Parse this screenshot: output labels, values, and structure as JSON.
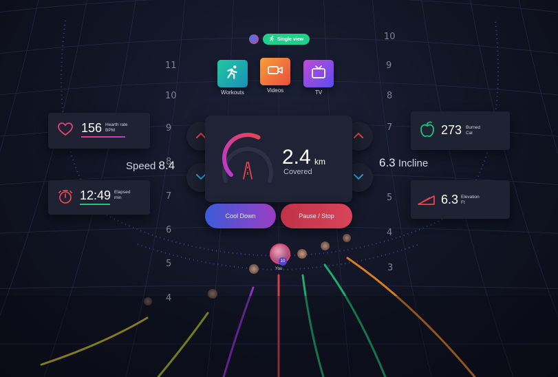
{
  "view_toggle": {
    "label": "Single view"
  },
  "apps": [
    {
      "label": "Workouts",
      "icon": "runner-icon",
      "color": "#18b8a6"
    },
    {
      "label": "Videos",
      "icon": "video-camera-icon",
      "color": "#f1663b"
    },
    {
      "label": "TV",
      "icon": "tv-icon",
      "color": "#7b4cf0"
    }
  ],
  "heart_rate": {
    "value": "156",
    "label1": "Hearth rate",
    "label2": "BPM",
    "icon": "heart-icon"
  },
  "elapsed": {
    "value": "12:49",
    "label1": "Elapsed",
    "label2": "min",
    "icon": "stopwatch-icon"
  },
  "calories": {
    "value": "273",
    "label1": "Burned",
    "label2": "Cal",
    "icon": "apple-icon"
  },
  "elevation": {
    "value": "6.3",
    "label1": "Elevation",
    "label2": "Ft",
    "icon": "incline-icon"
  },
  "speed": {
    "label": "Speed",
    "value": "8.4"
  },
  "incline": {
    "label": "Incline",
    "value": "6.3"
  },
  "distance": {
    "value": "2.4",
    "unit": "km",
    "label": "Covered",
    "progress": 0.6
  },
  "buttons": {
    "cool_down": "Cool Down",
    "pause_stop": "Pause / Stop"
  },
  "you_label": "You",
  "you_badge": "10",
  "left_scale": [
    "11",
    "10",
    "9",
    "8",
    "7",
    "6",
    "5",
    "4"
  ],
  "right_scale": [
    "10",
    "9",
    "8",
    "7",
    "6",
    "5",
    "4",
    "3"
  ],
  "colors": {
    "accent_heart": "#e8417a",
    "accent_green": "#26c281",
    "accent_red": "#e8454f",
    "cool_down_from": "#3b5bd9",
    "cool_down_to": "#9b3fc4",
    "pause_from": "#b8324a",
    "pause_to": "#d9445a"
  }
}
